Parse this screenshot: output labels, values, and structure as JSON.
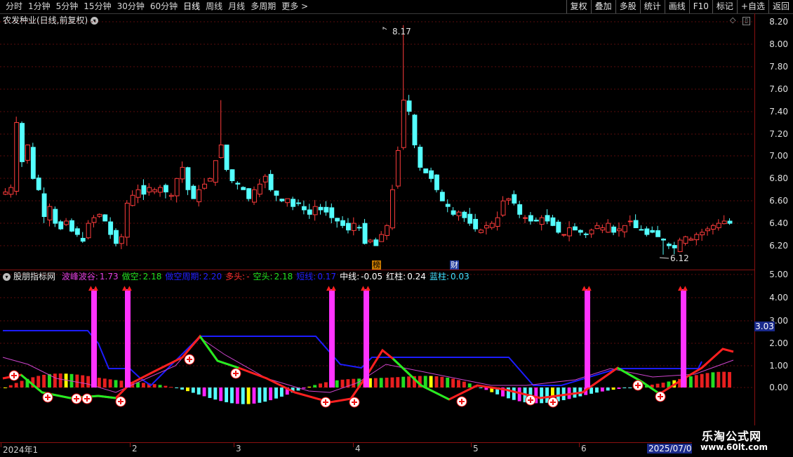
{
  "toolbar": {
    "periods": [
      "分时",
      "1分钟",
      "5分钟",
      "15分钟",
      "30分钟",
      "60分钟",
      "日线",
      "周线",
      "月线",
      "多周期",
      "更多 >"
    ],
    "active_period": "日线",
    "actions": [
      "复权",
      "叠加",
      "多股",
      "统计",
      "画线",
      "F10",
      "标记",
      "+自选",
      "返回"
    ]
  },
  "stock": {
    "title": "农发种业(日线,前复权)",
    "high_label": "8.17",
    "low_label": "6.12",
    "tags": [
      "榜",
      "财"
    ]
  },
  "price_axis": {
    "ticks": [
      "8.20",
      "8.00",
      "7.80",
      "7.60",
      "7.40",
      "7.20",
      "7.00",
      "6.80",
      "6.60",
      "6.40",
      "6.20"
    ]
  },
  "indicator": {
    "name": "股朋指标网",
    "items": [
      {
        "label": "波峰波谷:",
        "value": "1.73",
        "color": "#e040e0"
      },
      {
        "label": "做空:",
        "value": "2.18",
        "color": "#20e020"
      },
      {
        "label": "做空周期:",
        "value": "2.20",
        "color": "#2020ff"
      },
      {
        "label": "多头:",
        "value": "-",
        "color": "#ff3030"
      },
      {
        "label": "空头:",
        "value": "2.18",
        "color": "#20e020"
      },
      {
        "label": "短线:",
        "value": "0.17",
        "color": "#2020ff"
      },
      {
        "label": "中线:",
        "value": "-0.05",
        "color": "#ffffff"
      },
      {
        "label": "红柱:",
        "value": "0.24",
        "color": "#ffffff"
      },
      {
        "label": "蓝柱:",
        "value": "0.03",
        "color": "#40e0ff"
      }
    ],
    "axis_ticks": [
      "5.00",
      "4.00",
      "3.00",
      "2.00",
      "1.00",
      "0.00"
    ],
    "current_value": "3.03"
  },
  "date_axis": {
    "labels": [
      "2024年1",
      "2",
      "3",
      "4",
      "5",
      "6",
      "2025/07/0"
    ]
  },
  "watermark": {
    "title": "乐淘公式网",
    "url": "www.60lt.com"
  },
  "colors": {
    "up": "#ff3c3c",
    "down": "#54ffff",
    "grid": "#8a1010"
  }
}
